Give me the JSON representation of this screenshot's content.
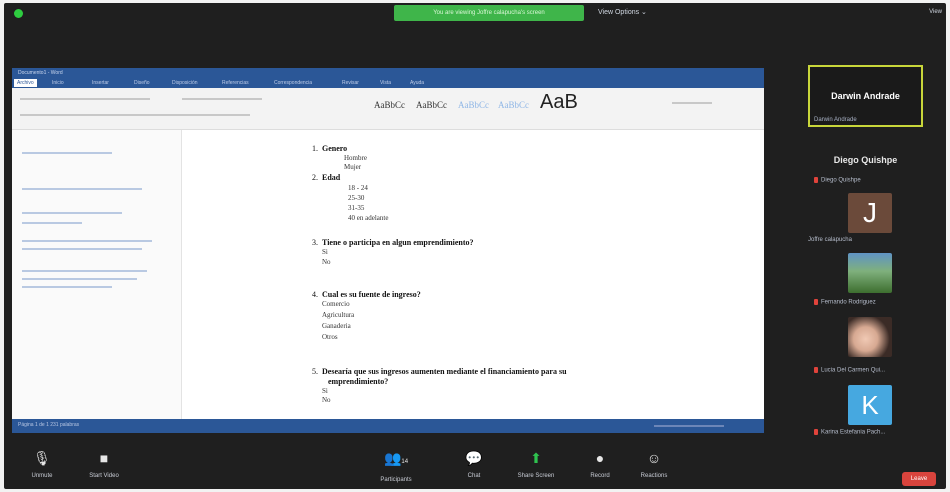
{
  "topbar": {
    "share_banner": "You are viewing Joffre calapucha's screen",
    "view_options": "View Options ⌄",
    "view_button": "View"
  },
  "word": {
    "title": "Documento1 - Word",
    "tabs": [
      "Archivo",
      "Inicio",
      "Insertar",
      "Diseño",
      "Disposición",
      "Referencias",
      "Correspondencia",
      "Revisar",
      "Vista",
      "Ayuda"
    ],
    "styles": [
      "AaBbCc",
      "AaBbCc",
      "AaBbCc",
      "AaBbCc"
    ],
    "style_big": "AaB",
    "status": "Página 1 de 1   231 palabras"
  },
  "document": {
    "questions": [
      {
        "num": "1.",
        "text": "Genero",
        "options": [
          "Hombre",
          "Mujer"
        ]
      },
      {
        "num": "2.",
        "text": "Edad",
        "options": [
          "18 - 24",
          "25-30",
          "31-35",
          "40 en adelante"
        ]
      },
      {
        "num": "3.",
        "text": "Tiene o participa en algun emprendimiento?",
        "options": [
          "Si",
          "No"
        ]
      },
      {
        "num": "4.",
        "text": "Cual es su fuente de ingreso?",
        "options": [
          "Comercio",
          "Agricultura",
          "Ganaderia",
          "Otros"
        ]
      },
      {
        "num": "5.",
        "text": "Desearía que sus ingresos aumenten mediante el financiamiento para su",
        "text2": "emprendimiento?",
        "options": [
          "Si",
          "No"
        ]
      }
    ]
  },
  "participants": {
    "active_name": "Darwin Andrade",
    "active_label": "Darwin Andrade",
    "second_title": "Diego Quishpe",
    "list": [
      {
        "name": "Diego Quishpe"
      },
      {
        "name": "Joffre calapucha",
        "initial": "J"
      },
      {
        "name": "Fernando Rodriguez"
      },
      {
        "name": "Lucia Del Carmen Qui..."
      },
      {
        "name": "Karina Estefania Pach...",
        "initial": "K"
      }
    ]
  },
  "toolbar": {
    "unmute": "Unmute",
    "start_video": "Start Video",
    "participants": "Participants",
    "participants_count": "14",
    "chat": "Chat",
    "share_screen": "Share Screen",
    "record": "Record",
    "reactions": "Reactions",
    "leave": "Leave"
  }
}
